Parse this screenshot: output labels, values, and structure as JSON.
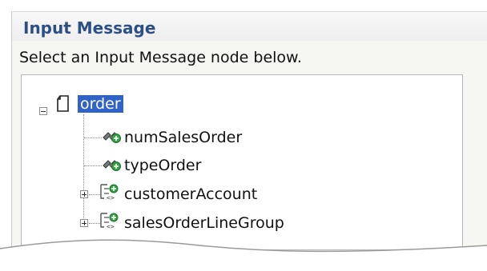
{
  "panel": {
    "title": "Input Message",
    "instruction": "Select an Input Message node below."
  },
  "tree": {
    "root": {
      "label": "order",
      "selected": true,
      "expanded": true,
      "icon": "document-icon"
    },
    "children": [
      {
        "label": "numSalesOrder",
        "icon": "element-field-icon",
        "expandable": false
      },
      {
        "label": "typeOrder",
        "icon": "element-field-icon",
        "expandable": false
      },
      {
        "label": "customerAccount",
        "icon": "complex-type-icon",
        "expandable": true
      },
      {
        "label": "salesOrderLineGroup",
        "icon": "complex-type-icon",
        "expandable": true
      }
    ]
  },
  "colors": {
    "title": "#2c4f86",
    "selection": "#2f63c8"
  }
}
